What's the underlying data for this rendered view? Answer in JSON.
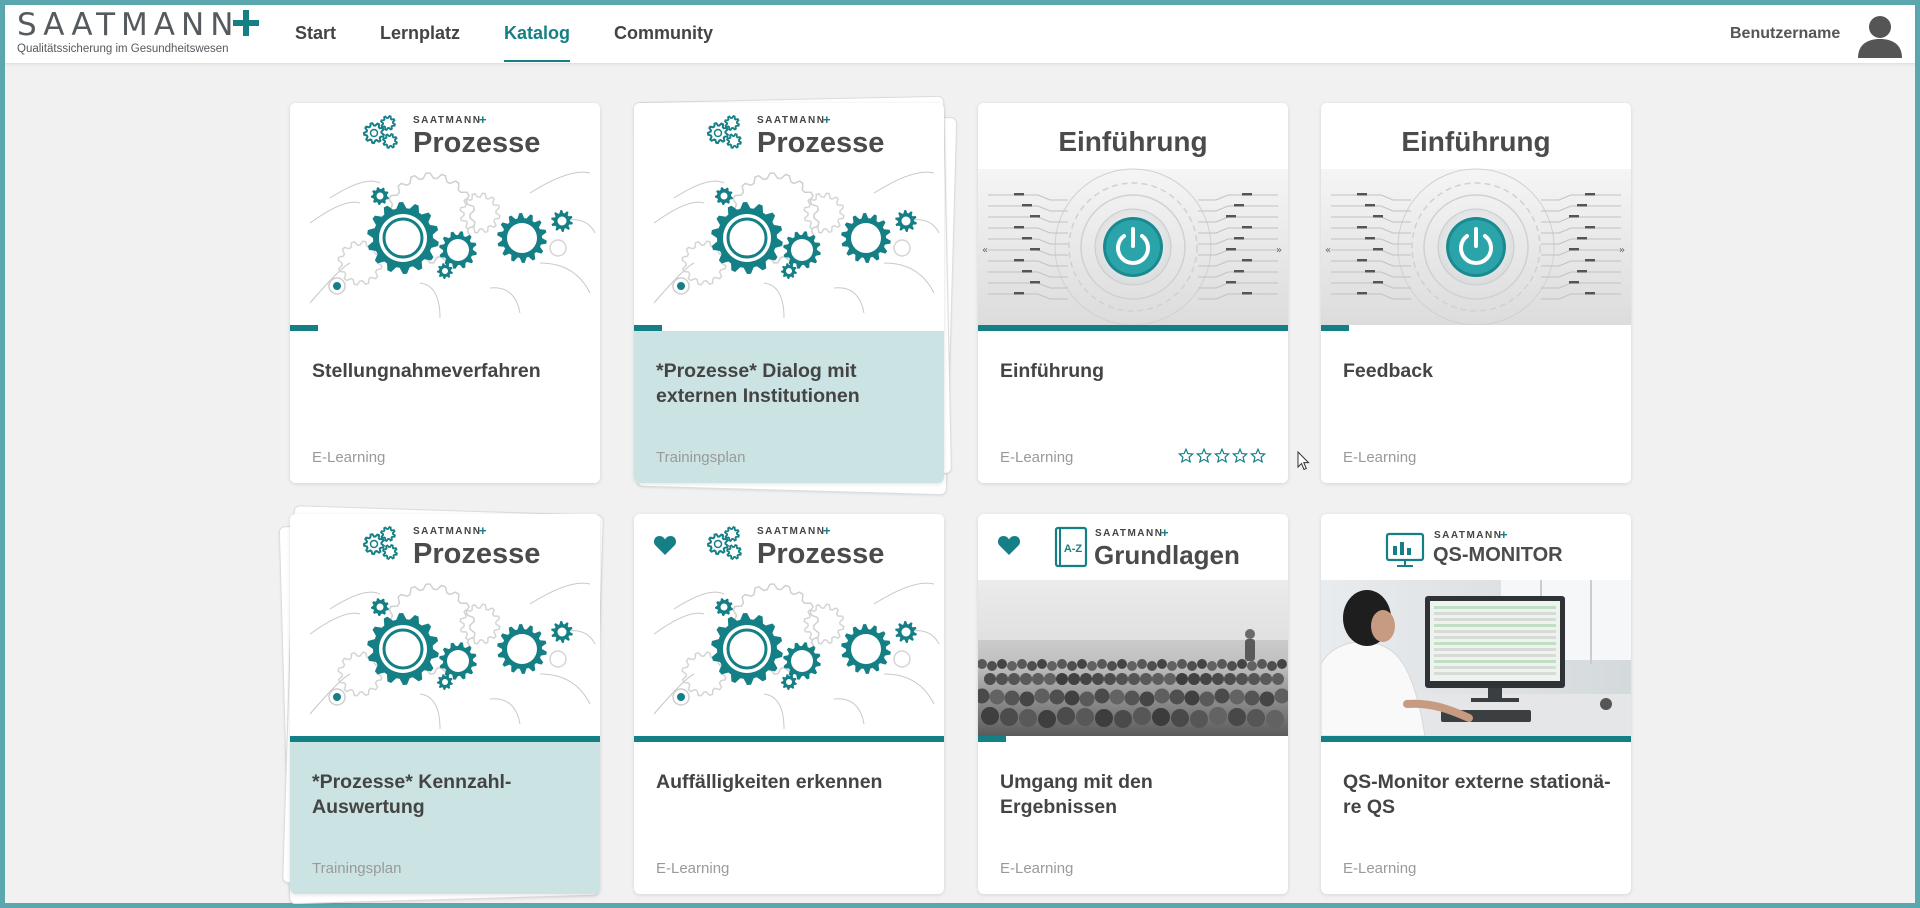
{
  "header": {
    "logo_word": "SAATMANN",
    "logo_tagline": "Qualitätssicherung im Gesundheitswesen",
    "nav": [
      {
        "label": "Start",
        "active": false
      },
      {
        "label": "Lernplatz",
        "active": false
      },
      {
        "label": "Katalog",
        "active": true
      },
      {
        "label": "Community",
        "active": false
      }
    ],
    "user_name": "Benutzername"
  },
  "colors": {
    "accent": "#157f86",
    "plan_body": "#cce3e3",
    "window_border": "#5aa8ad",
    "background": "#f1f1f1"
  },
  "image_texts": {
    "brand": "SAATMANN",
    "prozesse": "Prozesse",
    "einfuehrung": "Einführung",
    "grundlagen": "Grundlagen",
    "az": "A-Z",
    "qs_monitor": "QS-MONITOR"
  },
  "cards": [
    {
      "title": "Stellungnahmeverfahren",
      "type": "E-Learning",
      "image": "prozesse",
      "progress": 0.09,
      "favorite": false,
      "stacked": false
    },
    {
      "title": "*Prozesse* Dialog mit extern­en Institutionen",
      "type": "Trainingsplan",
      "image": "prozesse",
      "progress": 0.09,
      "favorite": false,
      "stacked": true
    },
    {
      "title": "Einführung",
      "type": "E-Learning",
      "image": "einfuehrung",
      "progress": 1.0,
      "favorite": false,
      "stacked": false,
      "rating": {
        "value": 0,
        "max": 5
      }
    },
    {
      "title": "Feedback",
      "type": "E-Learning",
      "image": "einfuehrung",
      "progress": 0.09,
      "favorite": false,
      "stacked": false
    },
    {
      "title": "*Prozesse* Kennzahl-Auswertung",
      "type": "Trainingsplan",
      "image": "prozesse",
      "progress": 1.0,
      "favorite": false,
      "stacked": true
    },
    {
      "title": "Auffälligkeiten erkennen",
      "type": "E-Learning",
      "image": "prozesse",
      "progress": 1.0,
      "favorite": true,
      "stacked": false
    },
    {
      "title": "Umgang mit den Ergebnissen",
      "type": "E-Learning",
      "image": "grundlagen",
      "progress": 0.09,
      "favorite": true,
      "stacked": false
    },
    {
      "title": "QS-Monitor externe stationä­re QS",
      "type": "E-Learning",
      "image": "qsmonitor",
      "progress": 1.0,
      "favorite": false,
      "stacked": false
    }
  ]
}
